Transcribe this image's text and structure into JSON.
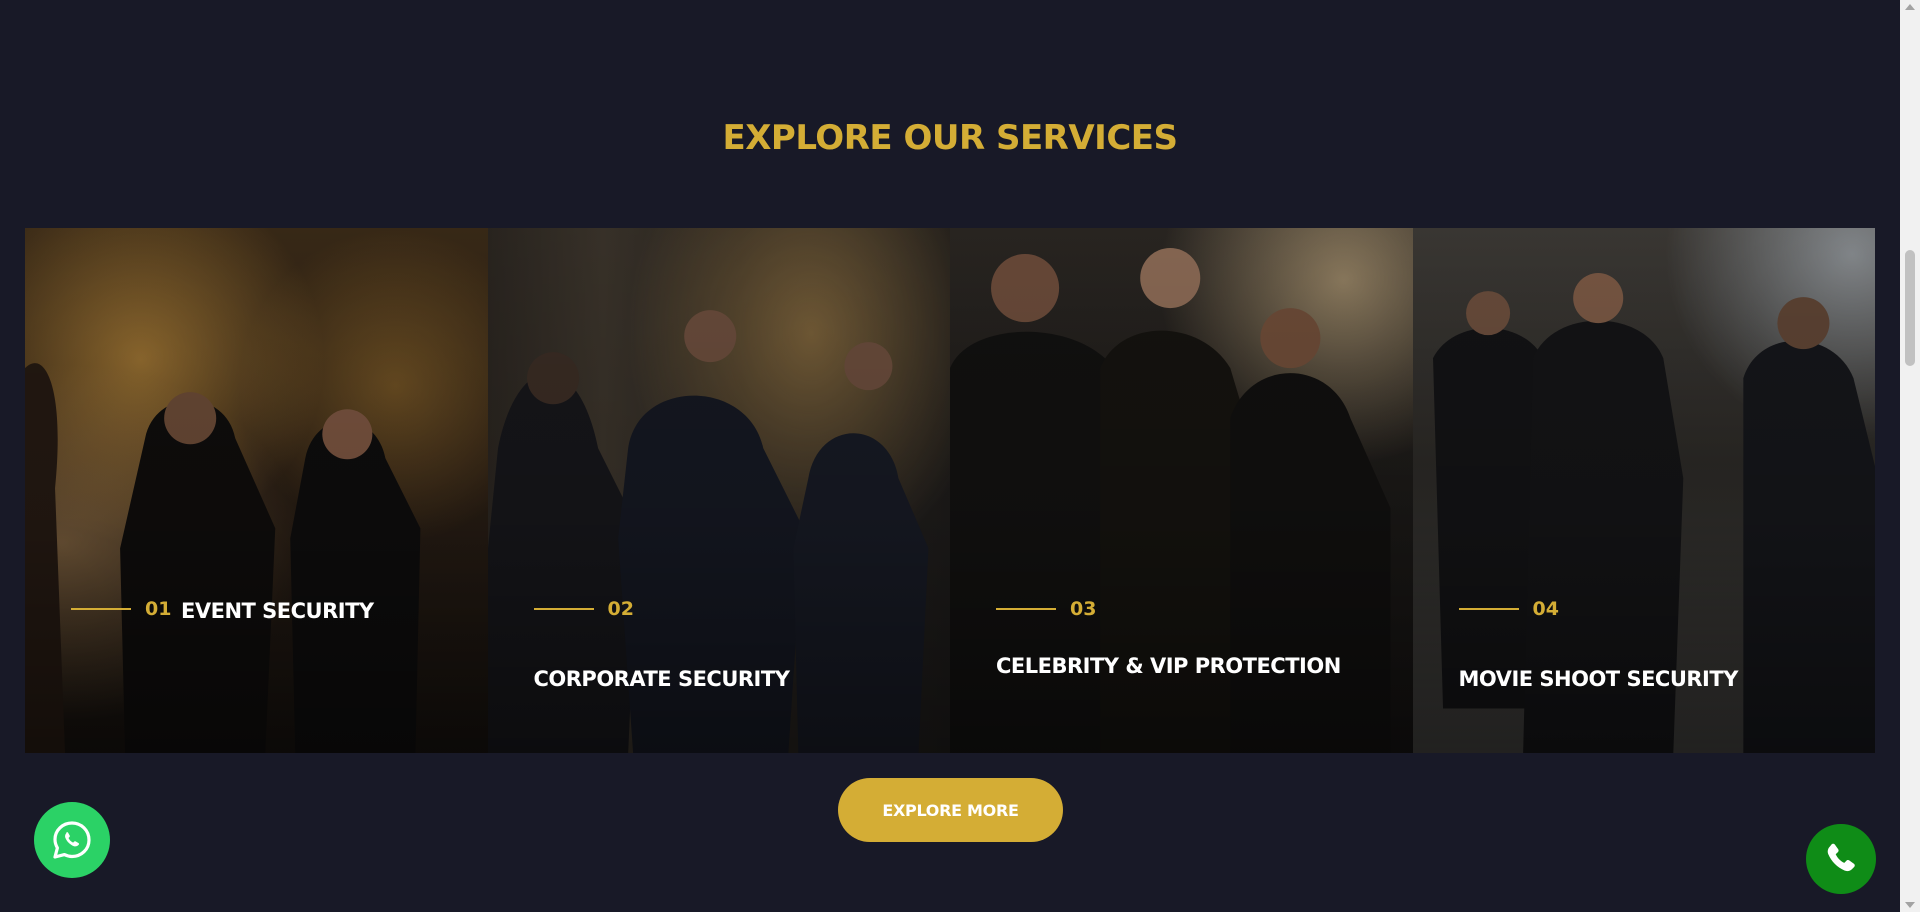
{
  "section": {
    "title": "EXPLORE OUR SERVICES"
  },
  "services": [
    {
      "number": "01",
      "name": "EVENT SECURITY"
    },
    {
      "number": "02",
      "name": "CORPORATE SECURITY"
    },
    {
      "number": "03",
      "name": "CELEBRITY & VIP PROTECTION"
    },
    {
      "number": "04",
      "name": "MOVIE SHOOT SECURITY"
    }
  ],
  "cta": {
    "label": "EXPLORE MORE"
  },
  "floating": {
    "whatsapp_icon": "whatsapp-icon",
    "phone_icon": "phone-icon",
    "whatsapp_color": "#2bd266",
    "phone_color": "#0f8c17"
  },
  "colors": {
    "background": "#181927",
    "accent": "#d4ad35",
    "card_text": "#ffffff"
  }
}
